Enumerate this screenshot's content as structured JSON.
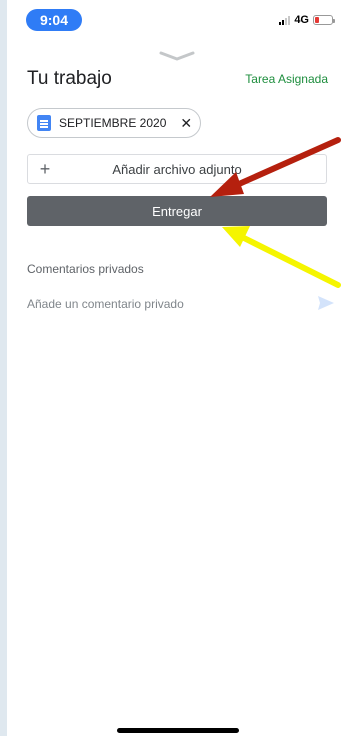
{
  "status_bar": {
    "time": "9:04",
    "network": "4G"
  },
  "assignment": {
    "title": "Tu trabajo",
    "status": "Tarea Asignada",
    "attachment": {
      "name": "SEPTIEMBRE 2020",
      "icon": "document-icon"
    },
    "add_file_label": "Añadir archivo adjunto",
    "submit_label": "Entregar"
  },
  "comments": {
    "title": "Comentarios privados",
    "placeholder": "Añade un comentario privado"
  },
  "colors": {
    "accent": "#2f7cf6",
    "status": "#1e8e3e",
    "submit": "#5f6368",
    "red_arrow": "#b5200e",
    "yellow_arrow": "#f5f500"
  }
}
